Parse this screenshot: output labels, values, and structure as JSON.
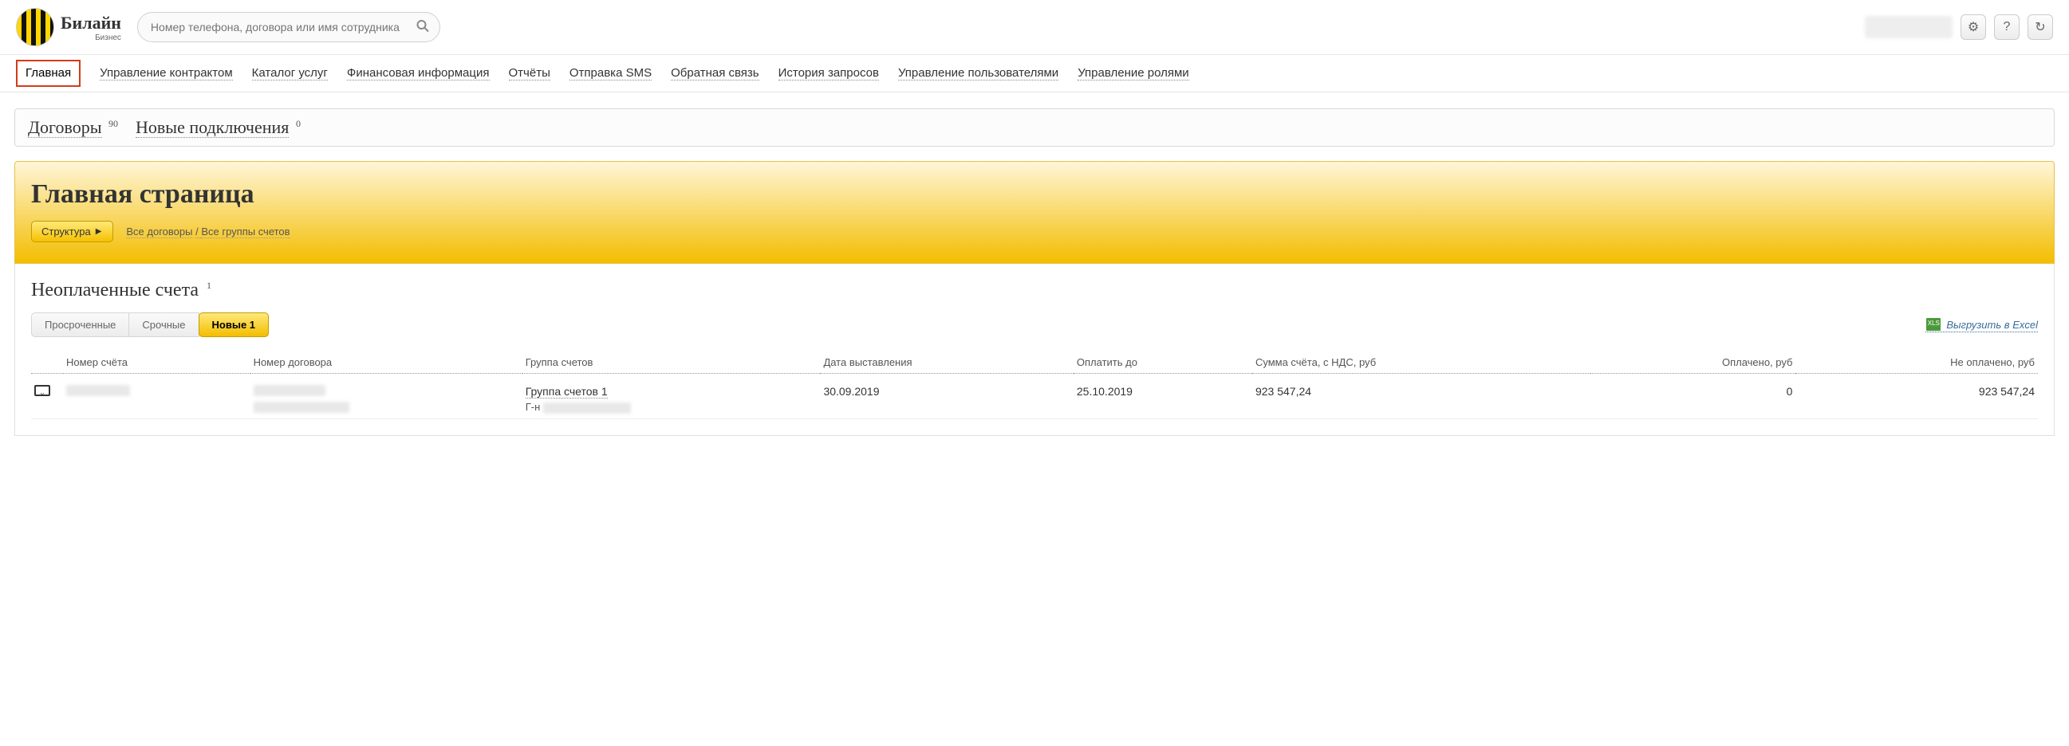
{
  "header": {
    "brand_main": "Билайн",
    "brand_sub": "Бизнес",
    "search_placeholder": "Номер телефона, договора или имя сотрудника"
  },
  "nav": {
    "items": [
      "Главная",
      "Управление контрактом",
      "Каталог услуг",
      "Финансовая информация",
      "Отчёты",
      "Отправка SMS",
      "Обратная связь",
      "История запросов",
      "Управление пользователями",
      "Управление ролями"
    ],
    "active_index": 0
  },
  "subtabs": {
    "contracts_label": "Договоры",
    "contracts_count": "90",
    "connections_label": "Новые подключения",
    "connections_count": "0"
  },
  "page": {
    "title": "Главная страница",
    "structure_btn": "Структура",
    "breadcrumb_all_contracts": "Все договоры",
    "breadcrumb_sep": " / ",
    "breadcrumb_all_groups": "Все группы счетов"
  },
  "invoices": {
    "title": "Неоплаченные счета",
    "count": "1",
    "filters": {
      "overdue": "Просроченные",
      "urgent": "Срочные",
      "new_label": "Новые 1"
    },
    "export_label": "Выгрузить в Excel",
    "columns": {
      "account_no": "Номер счёта",
      "contract_no": "Номер договора",
      "group": "Группа счетов",
      "issued": "Дата выставления",
      "pay_by": "Оплатить до",
      "amount": "Сумма счёта, с НДС, руб",
      "paid": "Оплачено, руб",
      "unpaid": "Не оплачено, руб"
    },
    "rows": [
      {
        "group_link": "Группа счетов 1",
        "group_sub_prefix": "Г-н",
        "issued": "30.09.2019",
        "pay_by": "25.10.2019",
        "amount": "923 547,24",
        "paid": "0",
        "unpaid": "923 547,24"
      }
    ]
  }
}
